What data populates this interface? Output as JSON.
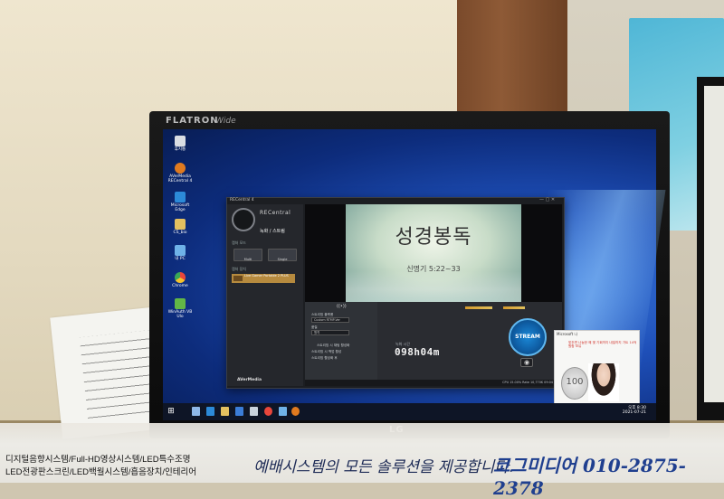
{
  "monitor": {
    "brand": "FLATRON",
    "brand_sub": "Wide",
    "maker": "LG"
  },
  "desktop_icons": [
    {
      "label": "휴지통",
      "color": "#d9dde3"
    },
    {
      "label": "AVerMedia RECentral 4",
      "color": "#e07a1f"
    },
    {
      "label": "Microsoft Edge",
      "color": "#2c8ad8"
    },
    {
      "label": "CS_bio",
      "color": "#e3c060"
    },
    {
      "label": "내 PC",
      "color": "#6fb2e8"
    },
    {
      "label": "Chrome",
      "color": "#e9463b"
    },
    {
      "label": "WinAuth VB Ulo",
      "color": "#62b846"
    }
  ],
  "app": {
    "window_title": "RECentral 4",
    "logo_text": "RECentral",
    "mode": "녹화 / 스트림",
    "section_mode": "캡처 모드",
    "mode_buttons": [
      "Multi",
      "Single"
    ],
    "section_source": "캡처 장치",
    "source_item": "Live Gamer Portable 2 PLUS",
    "brand": "AVerMedia",
    "slide": {
      "title": "성경봉독",
      "subtitle": "신명기 5:22~33"
    },
    "controls": {
      "platform_label": "스트리밍 플랫폼",
      "platform_value": "Custom RTMP-Ver",
      "quality_label": "품질",
      "quality_value": "원격",
      "option1": "스트리밍 시 채팅 활성화",
      "option2": "스트리밍 시 백업 활성",
      "option3": "스트리밍 활성화 후",
      "rec_time_label": "녹화 시간",
      "rec_time": "098h04m",
      "stream_button": "STREAM",
      "status_text": "CPU 15.00%  Rate 10,770K  09:04 PM"
    }
  },
  "notification": {
    "title": "Microsoft 나",
    "body": "맞추면 나눔한 혜 몇 기회까지 내일까지 가트 14억 원합 보유",
    "coin": "100"
  },
  "taskbar": {
    "time": "오후 8:30",
    "date": "2021-07-21"
  },
  "banner": {
    "left_line1": "디지털음향시스템/Full-HD영상시스템/LED특수조명",
    "left_line2": "LED전광판스크린/LED백월시스템/흡음장치/인테리어",
    "tagline": "예배시스템의 모든 솔루션을 제공합니다.",
    "phone": "코그미디어 010-2875-2378"
  }
}
